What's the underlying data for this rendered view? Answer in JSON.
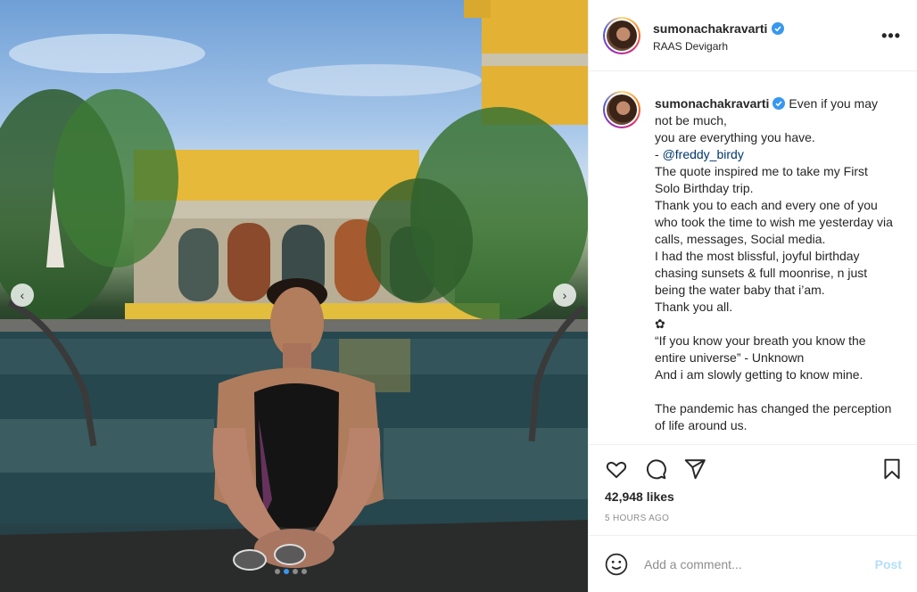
{
  "post": {
    "photo_alt_icon": "photo",
    "carousel_dots": 4,
    "active_dot": 1
  },
  "header": {
    "username": "sumonachakravarti",
    "location": "RAAS Devigarh",
    "more_icon": "more-horizontal-icon"
  },
  "caption": {
    "username": "sumonachakravarti",
    "line1": "Even if you may not be much,\nyou are everything you have.\n- ",
    "mention": "@freddy_birdy",
    "line2": "\nThe quote inspired me to take my First Solo Birthday trip.\nThank you to each and every one of you who took the time to wish me yesterday via calls, messages, Social media.\nI had the most blissful, joyful birthday chasing sunsets & full moonrise, n just being the water baby that i’am.\nThank you all.\n✿\n“If you know your breath you know the entire universe” - Unknown\nAnd i am slowly getting to know mine.\n\nThe pandemic has changed the perception of life around us."
  },
  "actions": {
    "likes": "42,948 likes",
    "time": "5 HOURS AGO"
  },
  "comment": {
    "placeholder": "Add a comment...",
    "post_label": "Post"
  },
  "colors": {
    "verified": "#3897f0",
    "post_disabled": "#b2dffc",
    "active_dot": "#3897f0"
  }
}
